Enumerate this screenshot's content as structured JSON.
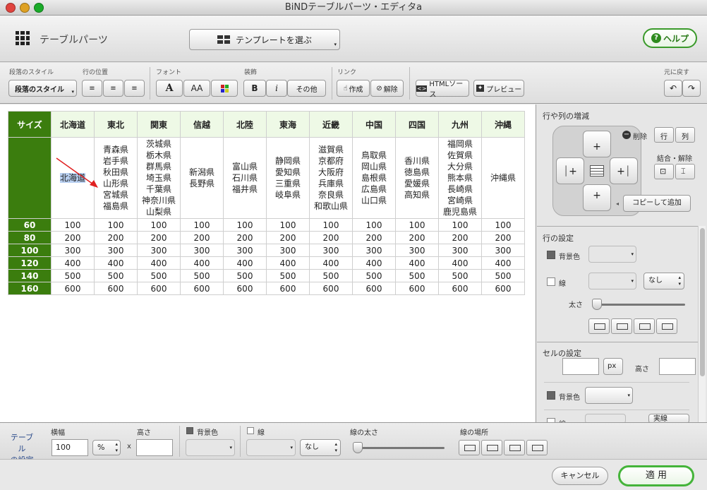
{
  "window": {
    "title": "BiNDテーブルパーツ・エディタa"
  },
  "header": {
    "title": "テーブルパーツ",
    "template_button": "テンプレートを選ぶ",
    "help_button": "ヘルプ"
  },
  "toolbar": {
    "para_style_label": "段落のスタイル",
    "para_style_value": "段落のスタイル",
    "row_pos_label": "行の位置",
    "font_label": "フォント",
    "deco_label": "装飾",
    "bold": "B",
    "italic": "i",
    "other": "その他",
    "link_label": "リンク",
    "link_make": "作成",
    "link_remove": "解除",
    "html_source": "HTMLソース",
    "preview": "プレビュー",
    "undo_label": "元に戻す",
    "font_a": "A",
    "font_aa": "AA"
  },
  "table": {
    "header": [
      "サイズ",
      "北海道",
      "東北",
      "関東",
      "信越",
      "北陸",
      "東海",
      "近畿",
      "中国",
      "四国",
      "九州",
      "沖縄"
    ],
    "prefectures": [
      [
        "北海道"
      ],
      [
        "青森県",
        "岩手県",
        "秋田県",
        "山形県",
        "宮城県",
        "福島県"
      ],
      [
        "茨城県",
        "栃木県",
        "群馬県",
        "埼玉県",
        "千葉県",
        "神奈川県",
        "山梨県"
      ],
      [
        "新潟県",
        "長野県"
      ],
      [
        "富山県",
        "石川県",
        "福井県"
      ],
      [
        "静岡県",
        "愛知県",
        "三重県",
        "岐阜県"
      ],
      [
        "滋賀県",
        "京都府",
        "大阪府",
        "兵庫県",
        "奈良県",
        "和歌山県"
      ],
      [
        "鳥取県",
        "岡山県",
        "島根県",
        "広島県",
        "山口県"
      ],
      [
        "香川県",
        "徳島県",
        "愛媛県",
        "高知県"
      ],
      [
        "福岡県",
        "佐賀県",
        "大分県",
        "熊本県",
        "長崎県",
        "宮崎県",
        "鹿児島県"
      ],
      [
        "沖縄県"
      ]
    ],
    "rows": [
      {
        "size": "60",
        "values": [
          "100",
          "100",
          "100",
          "100",
          "100",
          "100",
          "100",
          "100",
          "100",
          "100",
          "100"
        ]
      },
      {
        "size": "80",
        "values": [
          "200",
          "200",
          "200",
          "200",
          "200",
          "200",
          "200",
          "200",
          "200",
          "200",
          "200"
        ]
      },
      {
        "size": "100",
        "values": [
          "300",
          "300",
          "300",
          "300",
          "300",
          "300",
          "300",
          "300",
          "300",
          "300",
          "300"
        ]
      },
      {
        "size": "120",
        "values": [
          "400",
          "400",
          "400",
          "400",
          "400",
          "400",
          "400",
          "400",
          "400",
          "400",
          "400"
        ]
      },
      {
        "size": "140",
        "values": [
          "500",
          "500",
          "500",
          "500",
          "500",
          "500",
          "500",
          "500",
          "500",
          "500",
          "500"
        ]
      },
      {
        "size": "160",
        "values": [
          "600",
          "600",
          "600",
          "600",
          "600",
          "600",
          "600",
          "600",
          "600",
          "600",
          "600"
        ]
      }
    ]
  },
  "side": {
    "rowcol_title": "行や列の増減",
    "delete": "削除",
    "row": "行",
    "col": "列",
    "merge_split": "結合・解除",
    "copy_add": "コピーして追加",
    "row_settings": "行の設定",
    "bg_color": "背景色",
    "line": "線",
    "none": "なし",
    "thickness": "太さ",
    "cell_settings": "セルの設定",
    "px": "px",
    "height": "高さ",
    "solid": "実線"
  },
  "bottom": {
    "table_settings_1": "テーブル",
    "table_settings_2": "の設定",
    "width_label": "横幅",
    "width_value": "100",
    "unit": "%",
    "x": "x",
    "height_label": "高さ",
    "bg_label": "背景色",
    "line_label": "線",
    "none": "なし",
    "thickness_label": "線の太さ",
    "location_label": "線の場所"
  },
  "footer": {
    "cancel": "キャンセル",
    "apply": "適 用"
  },
  "colors": {
    "accent_green": "#3b7d0e",
    "header_bg": "#eef9e6",
    "help_green": "#2e8b1e"
  }
}
